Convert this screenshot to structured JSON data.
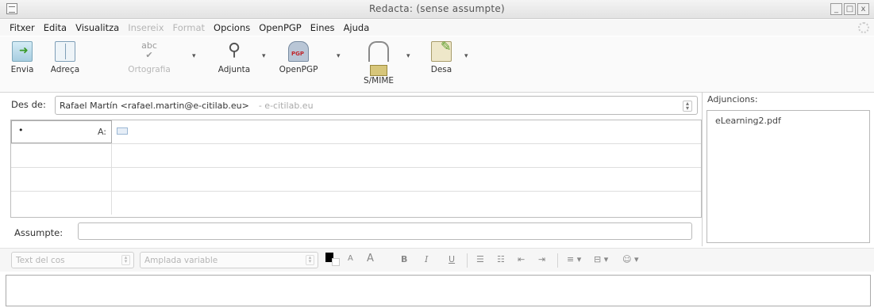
{
  "window": {
    "title": "Redacta: (sense assumpte)",
    "controls": [
      "_",
      "□",
      "x"
    ]
  },
  "menu": [
    {
      "label": "Fitxer",
      "enabled": true
    },
    {
      "label": "Edita",
      "enabled": true
    },
    {
      "label": "Visualitza",
      "enabled": true
    },
    {
      "label": "Insereix",
      "enabled": false
    },
    {
      "label": "Format",
      "enabled": false
    },
    {
      "label": "Opcions",
      "enabled": true
    },
    {
      "label": "OpenPGP",
      "enabled": true
    },
    {
      "label": "Eines",
      "enabled": true
    },
    {
      "label": "Ajuda",
      "enabled": true
    }
  ],
  "toolbar": {
    "send": "Envia",
    "address": "Adreça",
    "spell": "Ortografia",
    "spell_glyph": "abc",
    "attach": "Adjunta",
    "openpgp": "OpenPGP",
    "smime": "S/MIME",
    "save": "Desa"
  },
  "from": {
    "label": "Des de:",
    "value": "Rafael Martín <rafael.martin@e-citilab.eu>",
    "account": "- e-citilab.eu"
  },
  "recipients": [
    {
      "type": "A:"
    },
    {
      "type": ""
    },
    {
      "type": ""
    },
    {
      "type": ""
    }
  ],
  "subject": {
    "label": "Assumpte:",
    "value": ""
  },
  "attachments": {
    "title": "Adjuncions:",
    "items": [
      "eLearning2.pdf"
    ]
  },
  "format": {
    "paragraph": "Text del cos",
    "font": "Amplada variable",
    "buttons": {
      "smaller": "A",
      "larger": "A",
      "bold": "B",
      "italic": "I",
      "underline": "U",
      "bullets": "☰",
      "numbers": "☷",
      "outdent": "⇤",
      "indent": "⇥",
      "align": "≡ ▾",
      "insert": "⊟ ▾",
      "smiley": "☺ ▾"
    }
  },
  "colors": {
    "text_color": "#000000",
    "bg_color": "#ffffff"
  },
  "icons": [
    "send-icon",
    "address-book-icon",
    "spellcheck-icon",
    "paperclip-icon",
    "openpgp-icon",
    "lock-icon",
    "save-icon"
  ]
}
